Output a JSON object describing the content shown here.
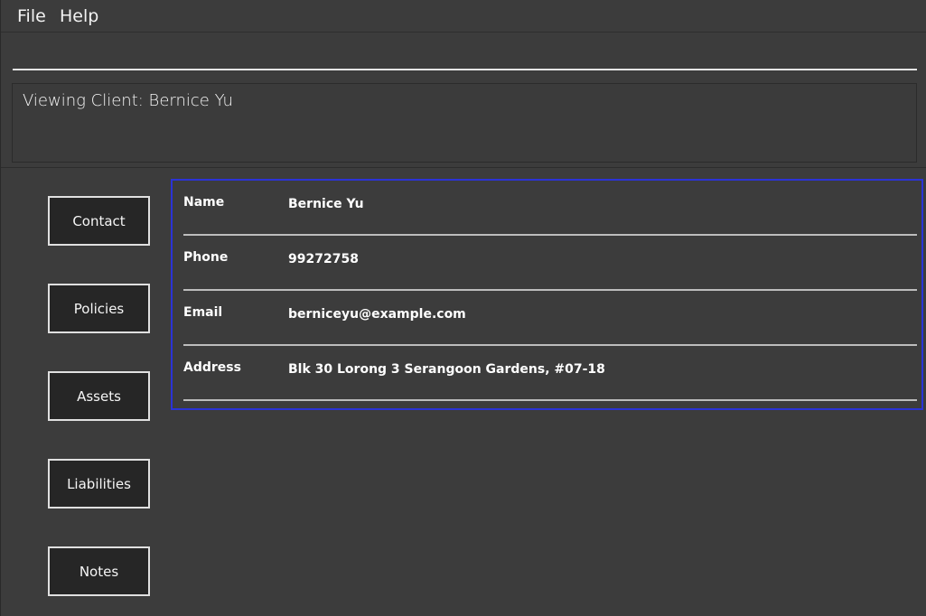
{
  "menu": {
    "file": "File",
    "help": "Help"
  },
  "command": {
    "value": "",
    "placeholder": ""
  },
  "result": {
    "text": "Viewing Client: Bernice Yu"
  },
  "tabs": [
    {
      "label": "Contact"
    },
    {
      "label": "Policies"
    },
    {
      "label": "Assets"
    },
    {
      "label": "Liabilities"
    },
    {
      "label": "Notes"
    }
  ],
  "contact": {
    "fields": [
      {
        "label": "Name",
        "value": "Bernice Yu"
      },
      {
        "label": "Phone",
        "value": "99272758"
      },
      {
        "label": "Email",
        "value": "berniceyu@example.com"
      },
      {
        "label": "Address",
        "value": "Blk 30 Lorong 3 Serangoon Gardens, #07-18"
      }
    ]
  },
  "colors": {
    "background": "#3c3c3c",
    "selected_panel_border": "#2b33d6",
    "button_background": "#262626",
    "button_border": "#e0e0e0"
  }
}
